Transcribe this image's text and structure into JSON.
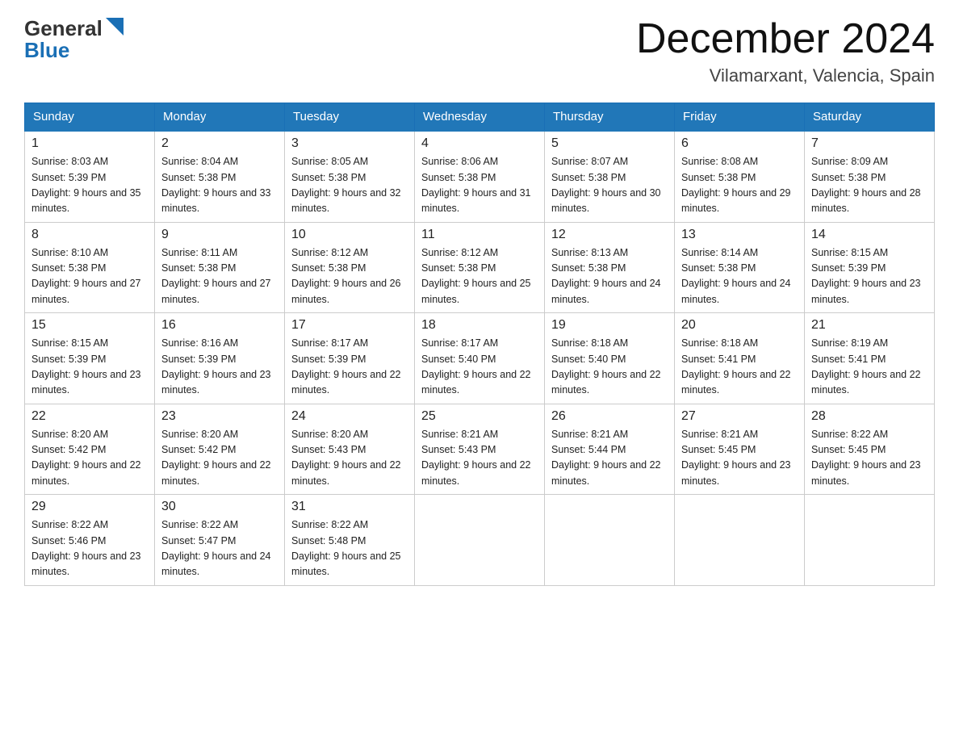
{
  "header": {
    "logo_general": "General",
    "logo_blue": "Blue",
    "month_title": "December 2024",
    "location": "Vilamarxant, Valencia, Spain"
  },
  "days_of_week": [
    "Sunday",
    "Monday",
    "Tuesday",
    "Wednesday",
    "Thursday",
    "Friday",
    "Saturday"
  ],
  "weeks": [
    [
      {
        "day": "1",
        "sunrise": "8:03 AM",
        "sunset": "5:39 PM",
        "daylight": "9 hours and 35 minutes."
      },
      {
        "day": "2",
        "sunrise": "8:04 AM",
        "sunset": "5:38 PM",
        "daylight": "9 hours and 33 minutes."
      },
      {
        "day": "3",
        "sunrise": "8:05 AM",
        "sunset": "5:38 PM",
        "daylight": "9 hours and 32 minutes."
      },
      {
        "day": "4",
        "sunrise": "8:06 AM",
        "sunset": "5:38 PM",
        "daylight": "9 hours and 31 minutes."
      },
      {
        "day": "5",
        "sunrise": "8:07 AM",
        "sunset": "5:38 PM",
        "daylight": "9 hours and 30 minutes."
      },
      {
        "day": "6",
        "sunrise": "8:08 AM",
        "sunset": "5:38 PM",
        "daylight": "9 hours and 29 minutes."
      },
      {
        "day": "7",
        "sunrise": "8:09 AM",
        "sunset": "5:38 PM",
        "daylight": "9 hours and 28 minutes."
      }
    ],
    [
      {
        "day": "8",
        "sunrise": "8:10 AM",
        "sunset": "5:38 PM",
        "daylight": "9 hours and 27 minutes."
      },
      {
        "day": "9",
        "sunrise": "8:11 AM",
        "sunset": "5:38 PM",
        "daylight": "9 hours and 27 minutes."
      },
      {
        "day": "10",
        "sunrise": "8:12 AM",
        "sunset": "5:38 PM",
        "daylight": "9 hours and 26 minutes."
      },
      {
        "day": "11",
        "sunrise": "8:12 AM",
        "sunset": "5:38 PM",
        "daylight": "9 hours and 25 minutes."
      },
      {
        "day": "12",
        "sunrise": "8:13 AM",
        "sunset": "5:38 PM",
        "daylight": "9 hours and 24 minutes."
      },
      {
        "day": "13",
        "sunrise": "8:14 AM",
        "sunset": "5:38 PM",
        "daylight": "9 hours and 24 minutes."
      },
      {
        "day": "14",
        "sunrise": "8:15 AM",
        "sunset": "5:39 PM",
        "daylight": "9 hours and 23 minutes."
      }
    ],
    [
      {
        "day": "15",
        "sunrise": "8:15 AM",
        "sunset": "5:39 PM",
        "daylight": "9 hours and 23 minutes."
      },
      {
        "day": "16",
        "sunrise": "8:16 AM",
        "sunset": "5:39 PM",
        "daylight": "9 hours and 23 minutes."
      },
      {
        "day": "17",
        "sunrise": "8:17 AM",
        "sunset": "5:39 PM",
        "daylight": "9 hours and 22 minutes."
      },
      {
        "day": "18",
        "sunrise": "8:17 AM",
        "sunset": "5:40 PM",
        "daylight": "9 hours and 22 minutes."
      },
      {
        "day": "19",
        "sunrise": "8:18 AM",
        "sunset": "5:40 PM",
        "daylight": "9 hours and 22 minutes."
      },
      {
        "day": "20",
        "sunrise": "8:18 AM",
        "sunset": "5:41 PM",
        "daylight": "9 hours and 22 minutes."
      },
      {
        "day": "21",
        "sunrise": "8:19 AM",
        "sunset": "5:41 PM",
        "daylight": "9 hours and 22 minutes."
      }
    ],
    [
      {
        "day": "22",
        "sunrise": "8:20 AM",
        "sunset": "5:42 PM",
        "daylight": "9 hours and 22 minutes."
      },
      {
        "day": "23",
        "sunrise": "8:20 AM",
        "sunset": "5:42 PM",
        "daylight": "9 hours and 22 minutes."
      },
      {
        "day": "24",
        "sunrise": "8:20 AM",
        "sunset": "5:43 PM",
        "daylight": "9 hours and 22 minutes."
      },
      {
        "day": "25",
        "sunrise": "8:21 AM",
        "sunset": "5:43 PM",
        "daylight": "9 hours and 22 minutes."
      },
      {
        "day": "26",
        "sunrise": "8:21 AM",
        "sunset": "5:44 PM",
        "daylight": "9 hours and 22 minutes."
      },
      {
        "day": "27",
        "sunrise": "8:21 AM",
        "sunset": "5:45 PM",
        "daylight": "9 hours and 23 minutes."
      },
      {
        "day": "28",
        "sunrise": "8:22 AM",
        "sunset": "5:45 PM",
        "daylight": "9 hours and 23 minutes."
      }
    ],
    [
      {
        "day": "29",
        "sunrise": "8:22 AM",
        "sunset": "5:46 PM",
        "daylight": "9 hours and 23 minutes."
      },
      {
        "day": "30",
        "sunrise": "8:22 AM",
        "sunset": "5:47 PM",
        "daylight": "9 hours and 24 minutes."
      },
      {
        "day": "31",
        "sunrise": "8:22 AM",
        "sunset": "5:48 PM",
        "daylight": "9 hours and 25 minutes."
      },
      null,
      null,
      null,
      null
    ]
  ]
}
